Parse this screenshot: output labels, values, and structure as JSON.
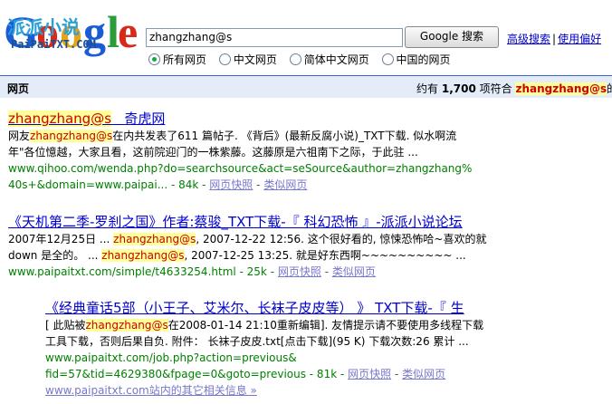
{
  "logo": {
    "text": "Google",
    "watermark_cn": "派派小说",
    "watermark_en": "PaiPaiTXT.COM"
  },
  "search": {
    "value": "zhangzhang@s",
    "button_label": "Google 搜索"
  },
  "toplinks": {
    "advanced": "高级搜索",
    "prefs": "使用偏好"
  },
  "radios": [
    {
      "label": "所有网页",
      "selected": true
    },
    {
      "label": "中文网页",
      "selected": false
    },
    {
      "label": "简体中文网页",
      "selected": false
    },
    {
      "label": "中国的网页",
      "selected": false
    }
  ],
  "bar": {
    "left": "网页",
    "prefix": "约有",
    "count": "1,700",
    "mid": "项符合",
    "query": "zhangzhang@s",
    "suffix": "的查"
  },
  "results": [
    {
      "title_hl": "zhangzhang@s",
      "title_rest": "奇虎网",
      "l1a": "网友",
      "l1hl": "zhangzhang@s",
      "l1b": "在内共发表了611 篇帖子. 《背后》(最新反腐小说)_TXT下载. 似水啊流",
      "l2": "年\"各位憶越，大家且看，这前院迎门的一株紫藤。这藤原是六祖南下之际，于此驻 ...",
      "url1": "www.qihoo.com/wenda.php?do=searchsource&act=seSource&author=zhangzhang%",
      "url2": "40s+&domain=www.paipai... - 84k -",
      "cache": "网页快照",
      "similar": "类似网页"
    },
    {
      "title": "《天机第二季-罗刹之国》作者:蔡骏_TXT下载-『 科幻恐怖 』-派派小说论坛",
      "l1a": "2007年12月25日 ...",
      "l1hl": "zhangzhang@s",
      "l1b": ", 2007-12-22 12:56. 这个很好看的, 惊悚恐怖哈~喜欢的就",
      "l2a": "down 是全的。 ...",
      "l2hl": "zhangzhang@s",
      "l2b": ", 2007-12-25 13:25. 就是好东西啊~~~~~~~~~~ ...",
      "url": "www.paipaitxt.com/simple/t4633254.html - 25k -",
      "cache": "网页快照",
      "similar": "类似网页"
    },
    {
      "title": "《经典童话5部（小王子、艾米尔、长袜子皮皮等） 》 TXT下载-『 生",
      "l1a": "[ 此贴被",
      "l1hl": "zhangzhang@s",
      "l1b": "在2008-01-14 21:10重新编辑]. 友情提示请不要使用多线程下载",
      "l2": "工具下载，否则后果自负. 附件： 长袜子皮皮.txt[点击下载](95 K) 下载次数:26 累计 ...",
      "url1": "www.paipaitxt.com/job.php?action=previous&",
      "url2": "fid=57&tid=4629380&fpage=0&goto=previous - 81k -",
      "cache": "网页快照",
      "similar": "类似网页",
      "more": "www.paipaitxt.com站内的其它相关信息 »"
    }
  ]
}
